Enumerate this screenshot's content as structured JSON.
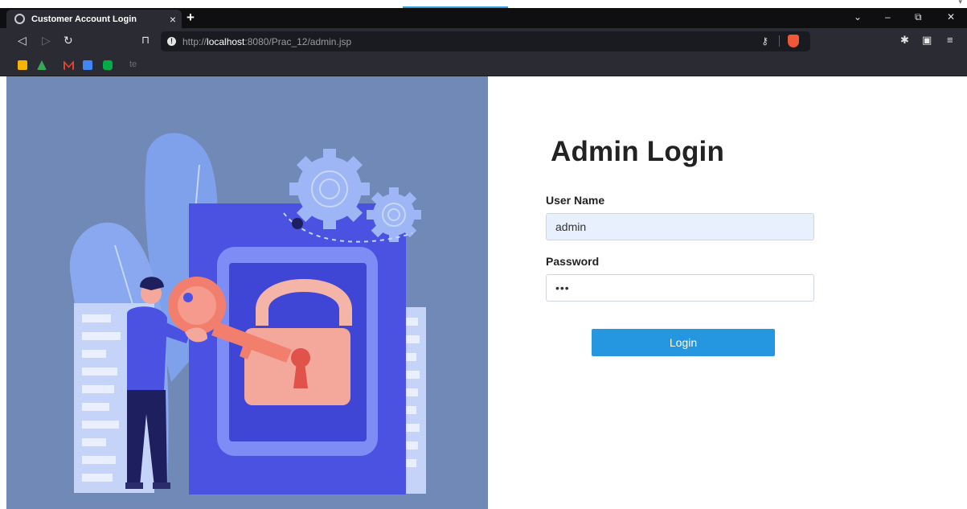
{
  "browser": {
    "tab_title": "Customer Account Login",
    "tab_close": "×",
    "new_tab": "+",
    "url_prefix": "http://",
    "url_host": "localhost",
    "url_rest": ":8080/Prac_12/admin.jsp",
    "window_controls": [
      "⌄",
      "–",
      "⧉",
      "✕"
    ],
    "bookmark_text": "te"
  },
  "login": {
    "heading": "Admin Login",
    "username_label": "User Name",
    "username_value": "admin",
    "password_label": "Password",
    "password_value": "•••",
    "login_button": "Login"
  },
  "colors": {
    "accent": "#2596e0",
    "illustration_bg": "#7189b6",
    "key": "#f27f6e",
    "lock_panel": "#4b51e0"
  }
}
